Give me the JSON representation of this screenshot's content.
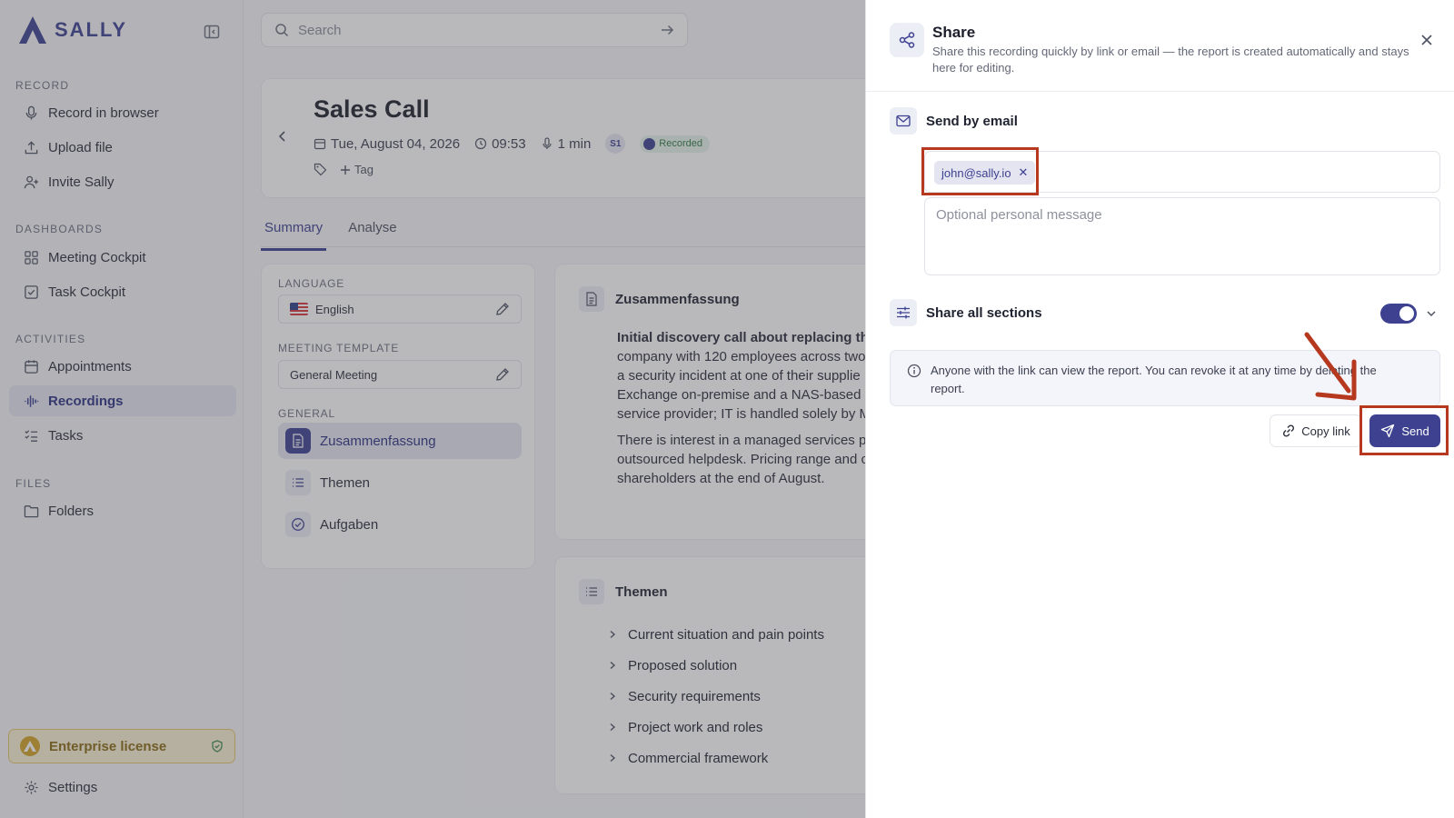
{
  "brand": {
    "name": "SALLY",
    "color": "#3d4190"
  },
  "sidebar": {
    "sections": [
      {
        "title": "RECORD",
        "items": [
          {
            "label": "Record in browser",
            "icon": "microphone-icon"
          },
          {
            "label": "Upload file",
            "icon": "upload-icon"
          },
          {
            "label": "Invite Sally",
            "icon": "user-plus-icon"
          }
        ]
      },
      {
        "title": "DASHBOARDS",
        "items": [
          {
            "label": "Meeting Cockpit",
            "icon": "grid-icon"
          },
          {
            "label": "Task Cockpit",
            "icon": "checkbox-icon"
          }
        ]
      },
      {
        "title": "ACTIVITIES",
        "items": [
          {
            "label": "Appointments",
            "icon": "calendar-icon"
          },
          {
            "label": "Recordings",
            "icon": "waveform-icon",
            "active": true
          },
          {
            "label": "Tasks",
            "icon": "list-check-icon"
          }
        ]
      },
      {
        "title": "FILES",
        "items": [
          {
            "label": "Folders",
            "icon": "folder-icon"
          }
        ]
      }
    ],
    "license_label": "Enterprise license",
    "settings_label": "Settings"
  },
  "search": {
    "placeholder": "Search"
  },
  "recording": {
    "title": "Sales Call",
    "date": "Tue, August 04, 2026",
    "time": "09:53",
    "duration": "1 min",
    "speaker_initials": "S1",
    "status": "Recorded",
    "tag_label": "Tag"
  },
  "tabs": [
    {
      "label": "Summary",
      "active": true
    },
    {
      "label": "Analyse",
      "active": false
    }
  ],
  "settings_card": {
    "language_label": "LANGUAGE",
    "language_value": "English",
    "template_label": "MEETING TEMPLATE",
    "template_value": "General Meeting",
    "general_label": "GENERAL",
    "sections": [
      {
        "label": "Zusammenfassung",
        "active": true
      },
      {
        "label": "Themen",
        "active": false
      },
      {
        "label": "Aufgaben",
        "active": false
      }
    ]
  },
  "summary_card": {
    "title": "Zusammenfassung",
    "paragraph1_lines": [
      "Initial discovery call about replacing the",
      "company with 120 employees across two",
      "a security incident at one of their supplie",
      "Exchange on-premise and a NAS-based",
      "service provider; IT is handled solely by M"
    ],
    "paragraph2_lines": [
      "There is interest in a managed services p",
      "outsourced helpdesk. Pricing range and c",
      "shareholders at the end of August."
    ]
  },
  "topics_card": {
    "title": "Themen",
    "items": [
      "Current situation and pain points",
      "Proposed solution",
      "Security requirements",
      "Project work and roles",
      "Commercial framework"
    ]
  },
  "share_panel": {
    "title": "Share",
    "description": "Share this recording quickly by link or email — the report is created automatically and stays here for editing.",
    "email_section_label": "Send by email",
    "recipient_chip": "john@sally.io",
    "message_placeholder": "Optional personal message",
    "share_all_label": "Share all sections",
    "share_all_enabled": true,
    "info_text": "Anyone with the link can view the report. You can revoke it at any time by deleting the report.",
    "copy_link_label": "Copy link",
    "send_label": "Send"
  },
  "colors": {
    "accent": "#3d4190",
    "annotation": "#b6391f",
    "license_bg": "#fbf1d2"
  }
}
